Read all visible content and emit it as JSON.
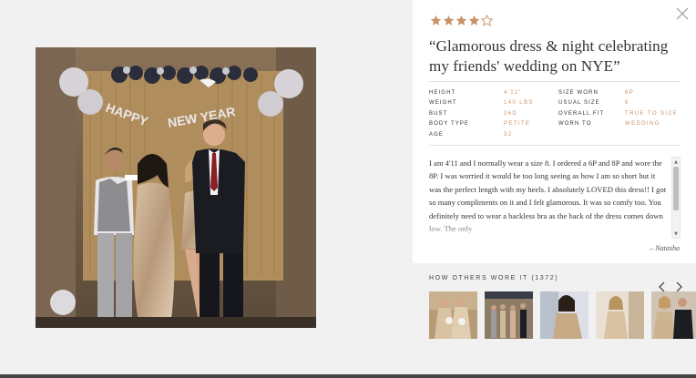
{
  "modal": {
    "close_icon": "close-icon"
  },
  "review": {
    "rating": 4,
    "rating_max": 5,
    "star_color": "#c9936a",
    "title": "“Glamorous dress & night celebrating my friends' wedding on NYE”",
    "specs": {
      "height_label": "HEIGHT",
      "height_value": "4'11\"",
      "weight_label": "WEIGHT",
      "weight_value": "140 LBS",
      "bust_label": "BUST",
      "bust_value": "36D",
      "body_type_label": "BODY TYPE",
      "body_type_value": "PETITE",
      "age_label": "AGE",
      "age_value": "32",
      "size_worn_label": "SIZE WORN",
      "size_worn_value": "8P",
      "usual_size_label": "USUAL SIZE",
      "usual_size_value": "6",
      "overall_fit_label": "OVERALL FIT",
      "overall_fit_value": "TRUE TO SIZE",
      "worn_to_label": "WORN TO",
      "worn_to_value": "WEDDING"
    },
    "body": "I am 4'11 and I normally wear a size 8. I ordered a 6P and 8P and wore the 8P. I was worried it would be too long seeing as how I am so short but it was the perfect length with my heels. I absolutely LOVED this dress!! I got so many compliments on it and I felt glamorous. It was so comfy too. You definitely need to wear a backless bra as the back of the dress comes down low. The only",
    "reviewer": "– Natasha"
  },
  "photo": {
    "banner_text": "HAPPY NEW YEAR"
  },
  "others": {
    "title": "HOW OTHERS WORE IT (1372)",
    "thumbnail_count": 5
  },
  "accent_color": "#c9936a"
}
